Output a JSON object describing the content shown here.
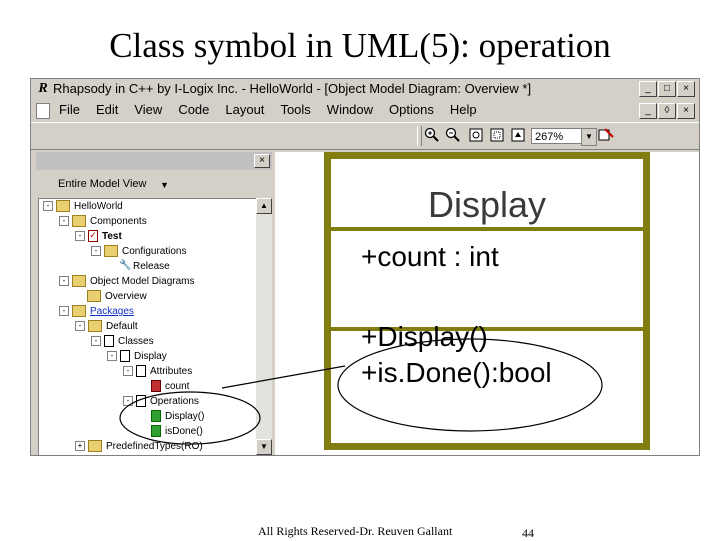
{
  "slide": {
    "title": "Class symbol in UML(5): operation",
    "footer": "All Rights Reserved-Dr. Reuven Gallant",
    "page_number": "44"
  },
  "window": {
    "app_icon": "R",
    "title": "Rhapsody in C++ by I-Logix Inc. - HelloWorld - [Object Model Diagram: Overview *]",
    "buttons": [
      "_",
      "□",
      "×"
    ]
  },
  "menu": {
    "items": [
      "File",
      "Edit",
      "View",
      "Code",
      "Layout",
      "Tools",
      "Window",
      "Options",
      "Help"
    ],
    "doc_buttons": [
      "_",
      "◊",
      "×"
    ]
  },
  "toolbar": {
    "zoom_in_icon": "zoom-in-icon",
    "zoom_out_icon": "zoom-out-icon",
    "zoom_value": "267%"
  },
  "browser": {
    "close": "×",
    "view_label": "Entire Model View",
    "tree": [
      {
        "label": "HelloWorld",
        "icon": "folder",
        "exp": "-"
      },
      {
        "label": "Components",
        "icon": "folder",
        "exp": "-"
      },
      {
        "label": "Test",
        "icon": "test",
        "exp": "-"
      },
      {
        "label": "Configurations",
        "icon": "cfg",
        "exp": "-"
      },
      {
        "label": "Release",
        "icon": "wrench",
        "exp": ""
      },
      {
        "label": "Object Model Diagrams",
        "icon": "folder",
        "exp": "-"
      },
      {
        "label": "Overview",
        "icon": "folder",
        "exp": ""
      },
      {
        "label": "Packages",
        "icon": "folder",
        "exp": "-"
      },
      {
        "label": "Default",
        "icon": "folder",
        "exp": "-"
      },
      {
        "label": "Classes",
        "icon": "cls",
        "exp": "-"
      },
      {
        "label": "Display",
        "icon": "cls",
        "exp": "-"
      },
      {
        "label": "Attributes",
        "icon": "cls",
        "exp": "-"
      },
      {
        "label": "count",
        "icon": "attr",
        "exp": ""
      },
      {
        "label": "Operations",
        "icon": "cls",
        "exp": "-"
      },
      {
        "label": "Display()",
        "icon": "op",
        "exp": ""
      },
      {
        "label": "isDone()",
        "icon": "op",
        "exp": ""
      },
      {
        "label": "PredefinedTypes(RO)",
        "icon": "folder",
        "exp": "+"
      }
    ]
  },
  "class_symbol": {
    "name": "Display",
    "attributes": [
      "+count : int"
    ],
    "operations": [
      "+Display()",
      "+is.Done():bool"
    ],
    "border_color": "#817d11"
  }
}
